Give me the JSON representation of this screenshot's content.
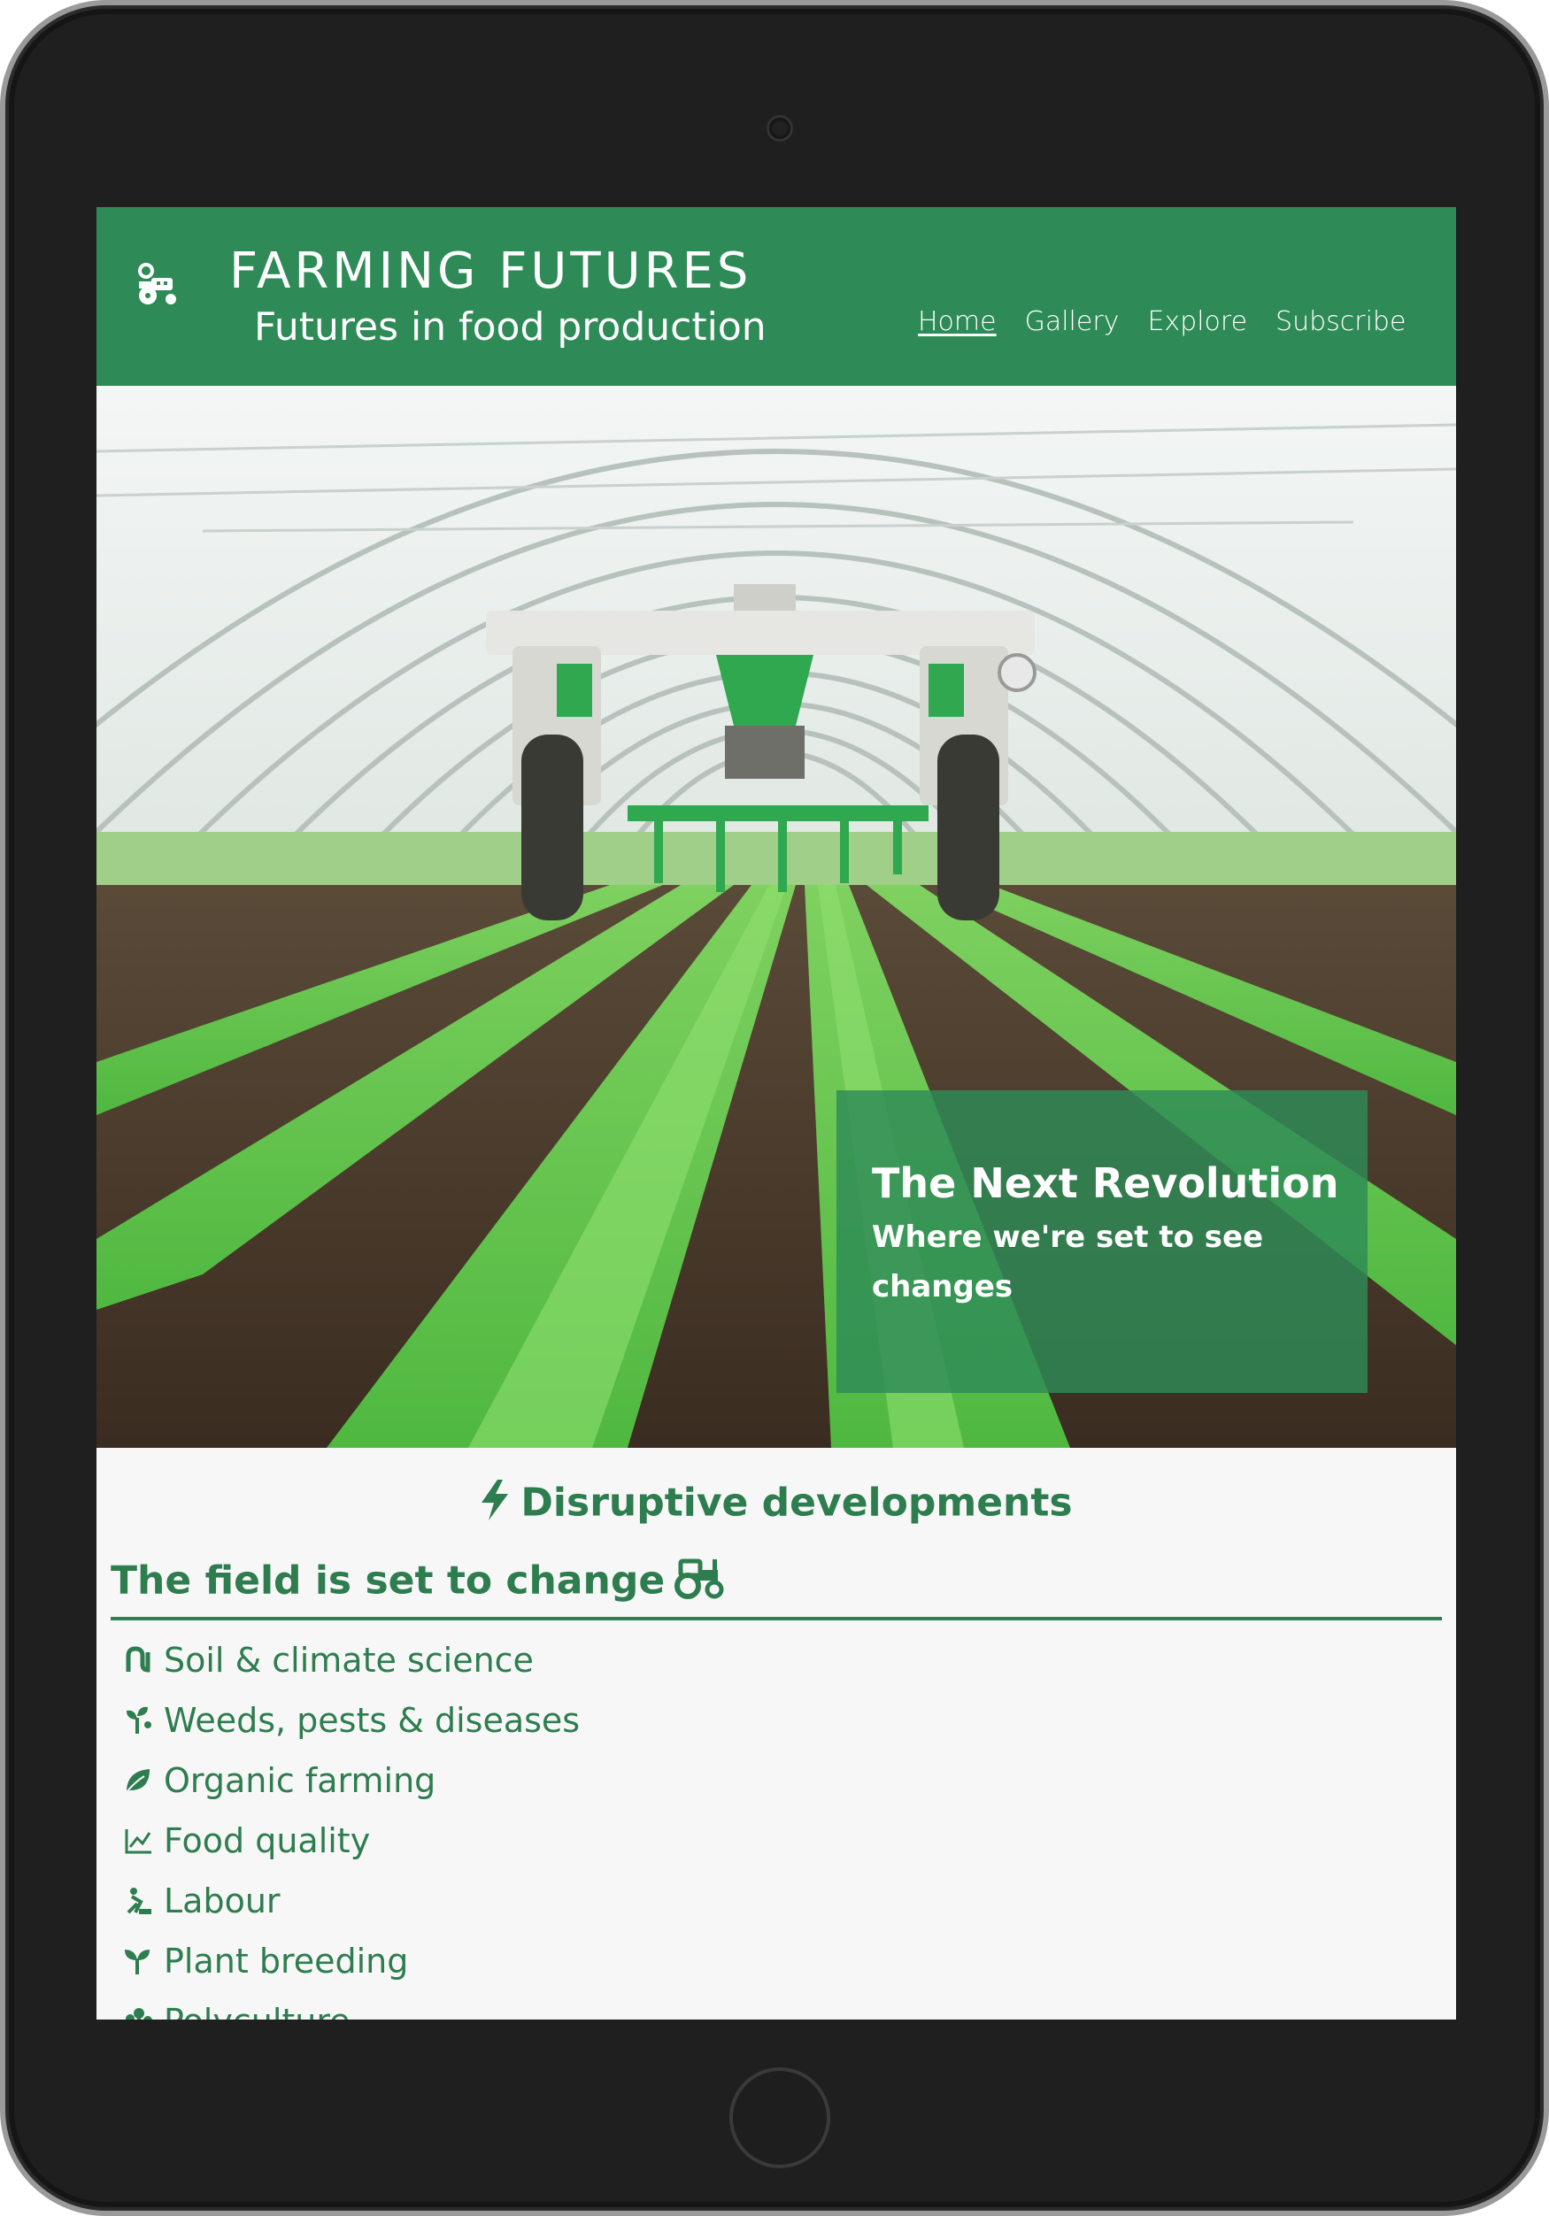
{
  "header": {
    "title": "FARMING FUTURES",
    "subtitle": "Futures in food production",
    "logo_icon": "robot-tractor-icon"
  },
  "nav": {
    "items": [
      {
        "label": "Home",
        "active": true
      },
      {
        "label": "Gallery",
        "active": false
      },
      {
        "label": "Explore",
        "active": false
      },
      {
        "label": "Subscribe",
        "active": false
      }
    ]
  },
  "hero": {
    "image": "agricultural robot weeding lettuce rows in a greenhouse tunnel",
    "caption_title": "The Next Revolution",
    "caption_text": "Where we're set to see changes"
  },
  "main": {
    "section_heading": "Disruptive developments",
    "section_icon": "lightning-bolt-icon",
    "sub_heading": "The field is set to change",
    "sub_heading_icon": "tractor-icon",
    "topics": [
      {
        "label": "Soil & climate science",
        "icon": "soil-icon"
      },
      {
        "label": "Weeds, pests & diseases",
        "icon": "sprout-pest-icon"
      },
      {
        "label": "Organic farming",
        "icon": "leaf-icon"
      },
      {
        "label": "Food quality",
        "icon": "line-chart-icon"
      },
      {
        "label": "Labour",
        "icon": "person-digging-icon"
      },
      {
        "label": "Plant breeding",
        "icon": "seedling-icon"
      },
      {
        "label": "Polyculture",
        "icon": "plants-icon"
      }
    ]
  },
  "colors": {
    "brand_green": "#2e8b57",
    "text_green": "#2e7d4f",
    "device_frame": "#1f1f1f"
  }
}
